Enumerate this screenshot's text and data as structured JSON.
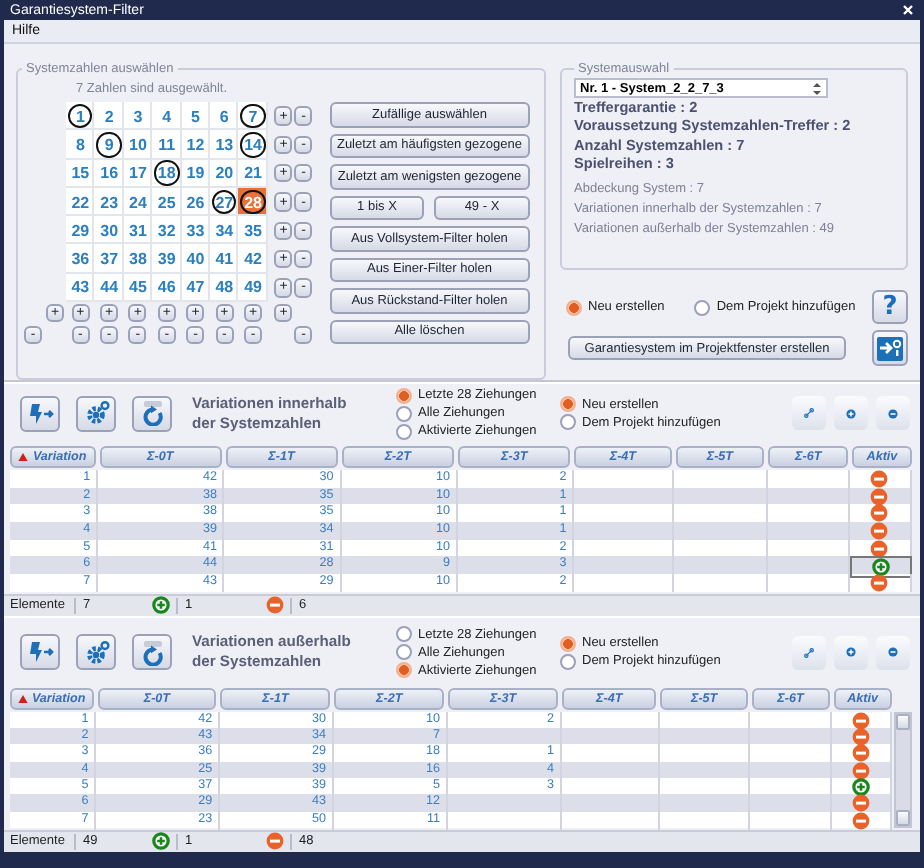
{
  "window": {
    "title": "Garantiesystem-Filter"
  },
  "menu": [
    {
      "label": "Hilfe"
    }
  ],
  "number_selection": {
    "title": "Systemzahlen auswählen",
    "status": "7 Zahlen sind ausgewählt.",
    "numbers": [
      {
        "label": "1",
        "selected": true,
        "focused": false
      },
      {
        "label": "2",
        "selected": false,
        "focused": false
      },
      {
        "label": "3",
        "selected": false,
        "focused": false
      },
      {
        "label": "4",
        "selected": false,
        "focused": false
      },
      {
        "label": "5",
        "selected": false,
        "focused": false
      },
      {
        "label": "6",
        "selected": false,
        "focused": false
      },
      {
        "label": "7",
        "selected": true,
        "focused": false
      },
      {
        "label": "8",
        "selected": false,
        "focused": false
      },
      {
        "label": "9",
        "selected": true,
        "focused": false
      },
      {
        "label": "10",
        "selected": false,
        "focused": false
      },
      {
        "label": "11",
        "selected": false,
        "focused": false
      },
      {
        "label": "12",
        "selected": false,
        "focused": false
      },
      {
        "label": "13",
        "selected": false,
        "focused": false
      },
      {
        "label": "14",
        "selected": true,
        "focused": false
      },
      {
        "label": "15",
        "selected": false,
        "focused": false
      },
      {
        "label": "16",
        "selected": false,
        "focused": false
      },
      {
        "label": "17",
        "selected": false,
        "focused": false
      },
      {
        "label": "18",
        "selected": true,
        "focused": false
      },
      {
        "label": "19",
        "selected": false,
        "focused": false
      },
      {
        "label": "20",
        "selected": false,
        "focused": false
      },
      {
        "label": "21",
        "selected": false,
        "focused": false
      },
      {
        "label": "22",
        "selected": false,
        "focused": false
      },
      {
        "label": "23",
        "selected": false,
        "focused": false
      },
      {
        "label": "24",
        "selected": false,
        "focused": false
      },
      {
        "label": "25",
        "selected": false,
        "focused": false
      },
      {
        "label": "26",
        "selected": false,
        "focused": false
      },
      {
        "label": "27",
        "selected": true,
        "focused": false
      },
      {
        "label": "28",
        "selected": true,
        "focused": true
      },
      {
        "label": "29",
        "selected": false,
        "focused": false
      },
      {
        "label": "30",
        "selected": false,
        "focused": false
      },
      {
        "label": "31",
        "selected": false,
        "focused": false
      },
      {
        "label": "32",
        "selected": false,
        "focused": false
      },
      {
        "label": "33",
        "selected": false,
        "focused": false
      },
      {
        "label": "34",
        "selected": false,
        "focused": false
      },
      {
        "label": "35",
        "selected": false,
        "focused": false
      },
      {
        "label": "36",
        "selected": false,
        "focused": false
      },
      {
        "label": "37",
        "selected": false,
        "focused": false
      },
      {
        "label": "38",
        "selected": false,
        "focused": false
      },
      {
        "label": "39",
        "selected": false,
        "focused": false
      },
      {
        "label": "40",
        "selected": false,
        "focused": false
      },
      {
        "label": "41",
        "selected": false,
        "focused": false
      },
      {
        "label": "42",
        "selected": false,
        "focused": false
      },
      {
        "label": "43",
        "selected": false,
        "focused": false
      },
      {
        "label": "44",
        "selected": false,
        "focused": false
      },
      {
        "label": "45",
        "selected": false,
        "focused": false
      },
      {
        "label": "46",
        "selected": false,
        "focused": false
      },
      {
        "label": "47",
        "selected": false,
        "focused": false
      },
      {
        "label": "48",
        "selected": false,
        "focused": false
      },
      {
        "label": "49",
        "selected": false,
        "focused": false
      }
    ],
    "row_buttons": [
      {
        "plus": "+",
        "minus": "-"
      },
      {
        "plus": "+",
        "minus": "-"
      },
      {
        "plus": "+",
        "minus": "-"
      },
      {
        "plus": "+",
        "minus": "-"
      },
      {
        "plus": "+",
        "minus": "-"
      },
      {
        "plus": "+",
        "minus": "-"
      },
      {
        "plus": "+",
        "minus": "-"
      }
    ],
    "column_plus": [
      "+",
      "+",
      "+",
      "+",
      "+",
      "+",
      "+",
      "+",
      "+"
    ],
    "column_minus": [
      "-",
      "-",
      "-",
      "-",
      "-",
      "-",
      "-",
      "-",
      "-"
    ],
    "actions": [
      [
        "Zufällige auswählen"
      ],
      [
        "Zuletzt am häufigsten gezogene"
      ],
      [
        "Zuletzt am wenigsten gezogene"
      ],
      [
        "1 bis X",
        "49 - X"
      ],
      [
        "Aus Vollsystem-Filter holen"
      ],
      [
        "Aus Einer-Filter holen"
      ],
      [
        "Aus Rückstand-Filter holen"
      ],
      [
        "Alle löschen"
      ]
    ]
  },
  "system": {
    "title": "Systemauswahl",
    "dropdown": "Nr. 1 - System_2_2_7_3",
    "stats": [
      {
        "text": "Treffergarantie : 2",
        "kind": "primary"
      },
      {
        "text": "Voraussetzung Systemzahlen-Treffer : 2",
        "kind": "primary"
      },
      {
        "text": "Anzahl Systemzahlen : 7",
        "kind": "primary"
      },
      {
        "text": "Spielreihen : 3",
        "kind": "primary"
      },
      {
        "text": "Abdeckung System : 7",
        "kind": "secondary"
      },
      {
        "text": "Variationen innerhalb der Systemzahlen : 7",
        "kind": "secondary"
      },
      {
        "text": "Variationen außerhalb der Systemzahlen : 49",
        "kind": "secondary"
      }
    ]
  },
  "create_mode": [
    {
      "label": "Neu erstellen",
      "selected": true
    },
    {
      "label": "Dem Projekt hinzufügen",
      "selected": false
    }
  ],
  "help_button": "?",
  "create_button": "Garantiesystem im Projektfenster erstellen",
  "sections": [
    {
      "title": "Variationen innerhalb\nder Systemzahlen",
      "draw_filter": [
        {
          "label": "Letzte 28 Ziehungen",
          "selected": true
        },
        {
          "label": "Alle Ziehungen",
          "selected": false
        },
        {
          "label": "Aktivierte Ziehungen",
          "selected": false
        }
      ],
      "mode": [
        {
          "label": "Neu erstellen",
          "selected": true
        },
        {
          "label": "Dem Projekt hinzufügen",
          "selected": false
        }
      ],
      "columns": [
        {
          "label": "Variation",
          "sorted": true
        },
        {
          "label": "Σ-0T",
          "sorted": false
        },
        {
          "label": "Σ-1T",
          "sorted": false
        },
        {
          "label": "Σ-2T",
          "sorted": false
        },
        {
          "label": "Σ-3T",
          "sorted": false
        },
        {
          "label": "Σ-4T",
          "sorted": false
        },
        {
          "label": "Σ-5T",
          "sorted": false
        },
        {
          "label": "Σ-6T",
          "sorted": false
        },
        {
          "label": "Aktiv",
          "sorted": false
        }
      ],
      "rows": [
        {
          "cells": [
            "1",
            "42",
            "30",
            "10",
            "2"
          ],
          "active": false,
          "focused": false
        },
        {
          "cells": [
            "2",
            "38",
            "35",
            "10",
            "1"
          ],
          "active": false,
          "focused": false
        },
        {
          "cells": [
            "3",
            "38",
            "35",
            "10",
            "1"
          ],
          "active": false,
          "focused": false
        },
        {
          "cells": [
            "4",
            "39",
            "34",
            "10",
            "1"
          ],
          "active": false,
          "focused": false
        },
        {
          "cells": [
            "5",
            "41",
            "31",
            "10",
            "2"
          ],
          "active": false,
          "focused": false
        },
        {
          "cells": [
            "6",
            "44",
            "28",
            "9",
            "3"
          ],
          "active": true,
          "focused": true
        },
        {
          "cells": [
            "7",
            "43",
            "29",
            "10",
            "2"
          ],
          "active": false,
          "focused": false
        }
      ],
      "scrollable": false,
      "footer": {
        "label": "Elemente",
        "total": "7",
        "active": "1",
        "inactive": "6"
      }
    },
    {
      "title": "Variationen außerhalb\nder Systemzahlen",
      "draw_filter": [
        {
          "label": "Letzte 28 Ziehungen",
          "selected": false
        },
        {
          "label": "Alle Ziehungen",
          "selected": false
        },
        {
          "label": "Aktivierte Ziehungen",
          "selected": true
        }
      ],
      "mode": [
        {
          "label": "Neu erstellen",
          "selected": true
        },
        {
          "label": "Dem Projekt hinzufügen",
          "selected": false
        }
      ],
      "columns": [
        {
          "label": "Variation",
          "sorted": true
        },
        {
          "label": "Σ-0T",
          "sorted": false
        },
        {
          "label": "Σ-1T",
          "sorted": false
        },
        {
          "label": "Σ-2T",
          "sorted": false
        },
        {
          "label": "Σ-3T",
          "sorted": false
        },
        {
          "label": "Σ-4T",
          "sorted": false
        },
        {
          "label": "Σ-5T",
          "sorted": false
        },
        {
          "label": "Σ-6T",
          "sorted": false
        },
        {
          "label": "Aktiv",
          "sorted": false
        }
      ],
      "rows": [
        {
          "cells": [
            "1",
            "42",
            "30",
            "10",
            "2"
          ],
          "active": false,
          "focused": false
        },
        {
          "cells": [
            "2",
            "43",
            "34",
            "7",
            null
          ],
          "active": false,
          "focused": false
        },
        {
          "cells": [
            "3",
            "36",
            "29",
            "18",
            "1"
          ],
          "active": false,
          "focused": false
        },
        {
          "cells": [
            "4",
            "25",
            "39",
            "16",
            "4"
          ],
          "active": false,
          "focused": false
        },
        {
          "cells": [
            "5",
            "37",
            "39",
            "5",
            "3"
          ],
          "active": true,
          "focused": false
        },
        {
          "cells": [
            "6",
            "29",
            "43",
            "12",
            null
          ],
          "active": false,
          "focused": false
        },
        {
          "cells": [
            "7",
            "23",
            "50",
            "11",
            null
          ],
          "active": false,
          "focused": false
        }
      ],
      "scrollable": true,
      "footer": {
        "label": "Elemente",
        "total": "49",
        "active": "1",
        "inactive": "48"
      }
    }
  ]
}
